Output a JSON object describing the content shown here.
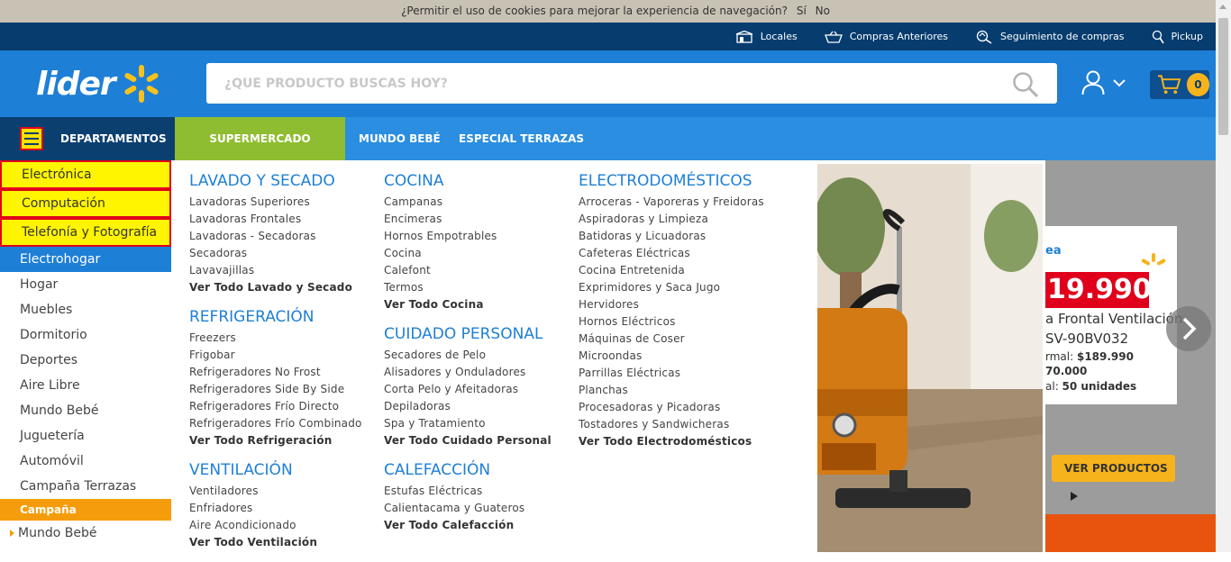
{
  "cookie": {
    "text": "¿Permitir el uso de cookies para mejorar la experiencia de navegación?",
    "yes": "Sí",
    "no": "No"
  },
  "topbar": {
    "links": [
      "Locales",
      "Compras Anteriores",
      "Seguimiento de compras",
      "Pickup"
    ]
  },
  "header": {
    "logo": "lider",
    "search_placeholder": "¿QUÉ PRODUCTO BUSCAS HOY?",
    "cart_count": "0"
  },
  "nav": {
    "departments": "DEPARTAMENTOS",
    "supermarket": "SUPERMERCADO",
    "tabs": [
      "MUNDO BEBÉ",
      "ESPECIAL TERRAZAS"
    ]
  },
  "sidebar": {
    "items": [
      "Electrónica",
      "Computación",
      "Telefonía y Fotografía",
      "Electrohogar",
      "Hogar",
      "Muebles",
      "Dormitorio",
      "Deportes",
      "Aire Libre",
      "Mundo Bebé",
      "Juguetería",
      "Automóvil",
      "Campaña Terrazas"
    ],
    "campaign": "Campaña",
    "campaign_item": "Mundo Bebé"
  },
  "mega": {
    "col1": [
      {
        "title": "LAVADO Y SECADO",
        "items": [
          "Lavadoras Superiores",
          "Lavadoras Frontales",
          "Lavadoras - Secadoras",
          "Secadoras",
          "Lavavajillas"
        ],
        "all": "Ver Todo Lavado y Secado"
      },
      {
        "title": "REFRIGERACIÓN",
        "items": [
          "Freezers",
          "Frigobar",
          "Refrigeradores No Frost",
          "Refrigeradores Side By Side",
          "Refrigeradores Frío Directo",
          "Refrigeradores Frío Combinado"
        ],
        "all": "Ver Todo Refrigeración"
      },
      {
        "title": "VENTILACIÓN",
        "items": [
          "Ventiladores",
          "Enfriadores",
          "Aire Acondicionado"
        ],
        "all": "Ver Todo Ventilación"
      }
    ],
    "col2": [
      {
        "title": "COCINA",
        "items": [
          "Campanas",
          "Encimeras",
          "Hornos Empotrables",
          "Cocina",
          "Calefont",
          "Termos"
        ],
        "all": "Ver Todo Cocina"
      },
      {
        "title": "CUIDADO PERSONAL",
        "items": [
          "Secadores de Pelo",
          "Alisadores y Onduladores",
          "Corta Pelo y Afeitadoras",
          "Depiladoras",
          "Spa y Tratamiento"
        ],
        "all": "Ver Todo Cuidado Personal"
      },
      {
        "title": "CALEFACCIÓN",
        "items": [
          "Estufas Eléctricas",
          "Calientacama y Guateros"
        ],
        "all": "Ver Todo Calefacción"
      }
    ],
    "col3": [
      {
        "title": "ELECTRODOMÉSTICOS",
        "items": [
          "Arroceras - Vaporeras y Freidoras",
          "Aspiradoras y Limpieza",
          "Batidoras y Licuadoras",
          "Cafeteras Eléctricas",
          "Cocina Entretenida",
          "Exprimidores y Saca Jugo",
          "Hervidores",
          "Hornos Eléctricos",
          "Máquinas de Coser",
          "Microondas",
          "Parrillas Eléctricas",
          "Planchas",
          "Procesadoras y Picadoras",
          "Tostadores y Sandwicheras"
        ],
        "all": "Ver Todo Electrodomésticos"
      }
    ]
  },
  "banner": {
    "brand": "ea",
    "price": "19.990",
    "line1": "a Frontal Ventilación",
    "line2": "SV-90BV032",
    "normal_label": "rmal: ",
    "normal_value": "$189.990",
    "price2": "70.000",
    "stock_label": "al: ",
    "stock_value": "50 unidades",
    "button": "VER PRODUCTOS"
  },
  "colors": {
    "brand_blue": "#1e7fd6",
    "dark_blue": "#063c6e",
    "green": "#8fbd31",
    "yellow": "#f7b31b",
    "orange": "#f59c0c"
  }
}
